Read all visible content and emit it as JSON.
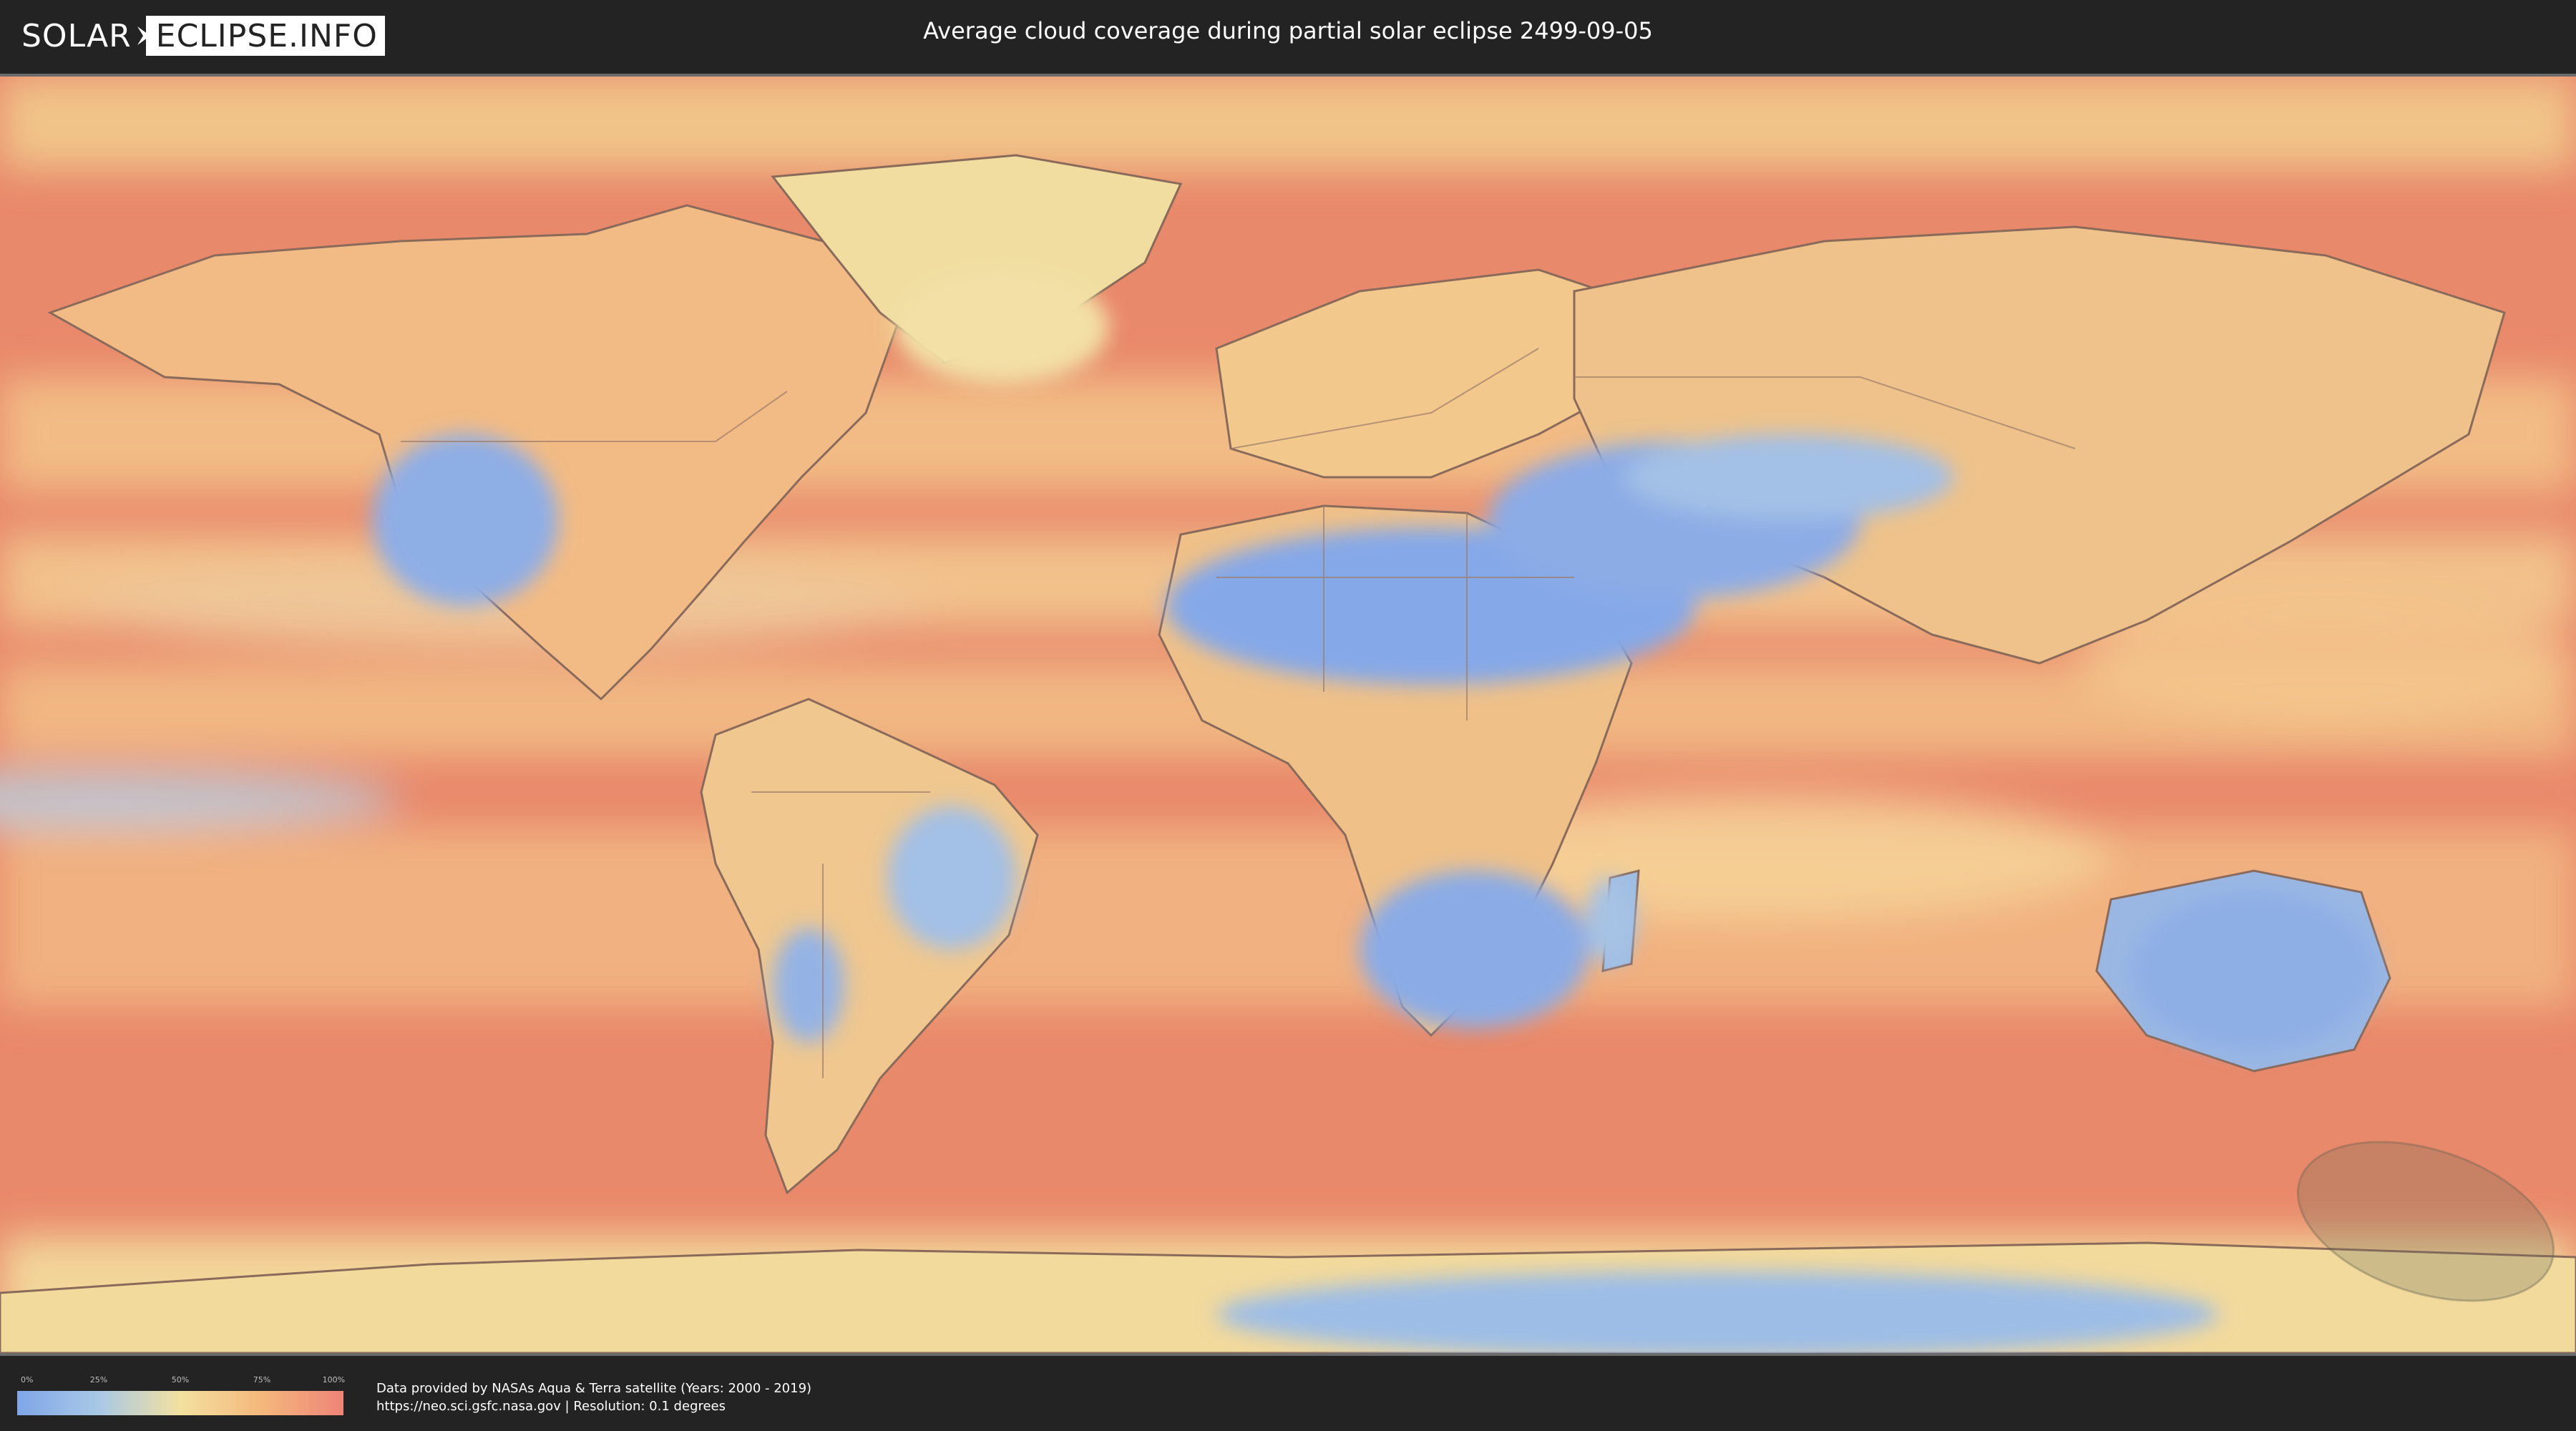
{
  "header": {
    "logo_left": "SOLAR",
    "logo_right": "ECLIPSE.INFO",
    "title": "Average cloud coverage during partial solar eclipse 2499-09-05"
  },
  "legend": {
    "ticks": [
      "0%",
      "25%",
      "50%",
      "75%",
      "100%"
    ],
    "colors": [
      "#7fa6e8",
      "#a9c8e6",
      "#f3e1a0",
      "#f4b87c",
      "#ee8477"
    ]
  },
  "credits": {
    "line1": "Data provided by NASAs Aqua & Terra satellite (Years: 2000 - 2019)",
    "line2": "https://neo.sci.gsfc.nasa.gov | Resolution: 0.1 degrees"
  },
  "map": {
    "ocean_color": "#e8876a",
    "clear_color": "#7fa6e8",
    "land_outline_color": "#8a6a5a",
    "eclipse_shadow_color": "#6f6f5a"
  }
}
